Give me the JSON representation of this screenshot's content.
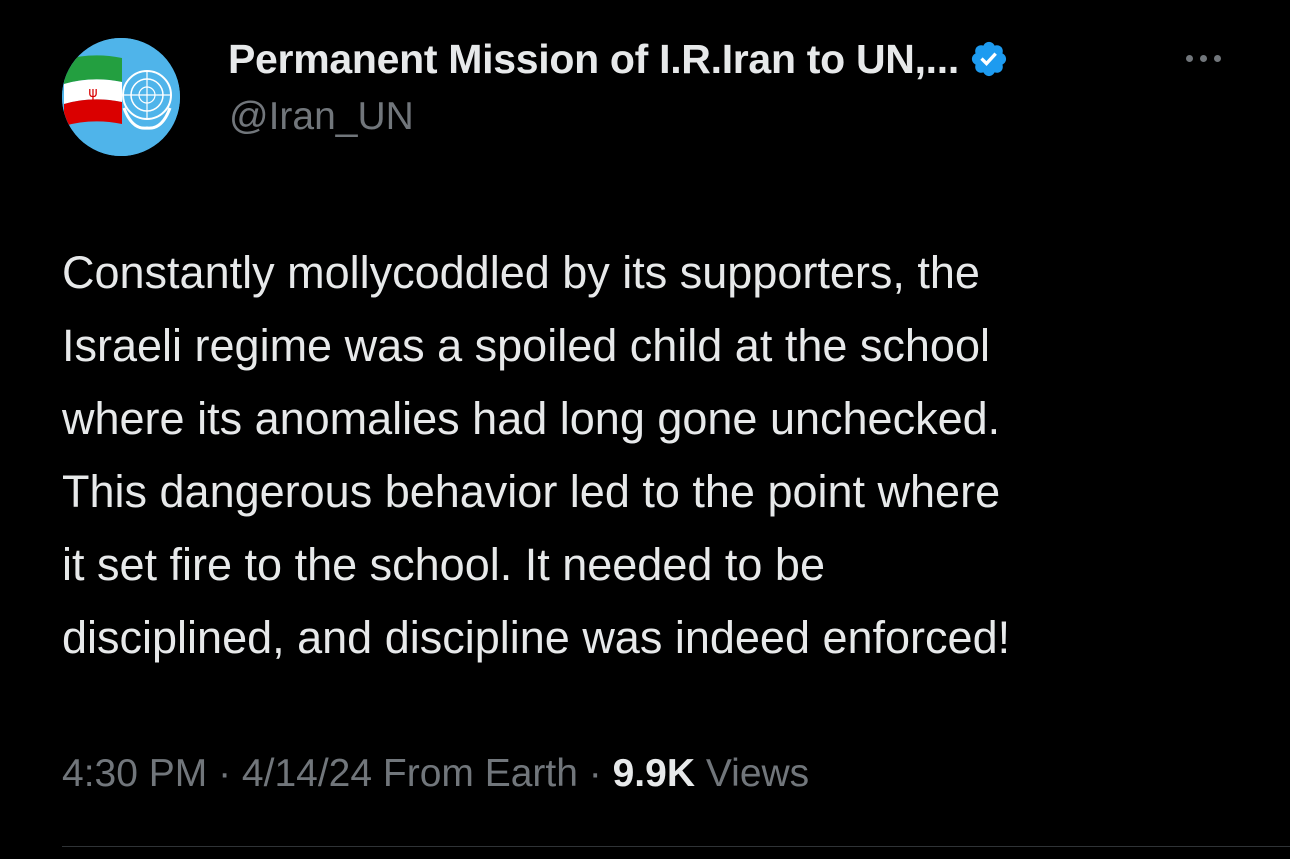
{
  "author": {
    "display_name": "Permanent Mission of I.R.Iran to UN,...",
    "handle": "@Iran_UN",
    "verified": true,
    "avatar_icon": "iran-flag-un-emblem-avatar"
  },
  "menu": {
    "icon": "more-options-icon"
  },
  "tweet": {
    "lines": [
      "Constantly mollycoddled by its supporters, the",
      "Israeli regime was a spoiled child at the school",
      "where its anomalies had long gone unchecked.",
      "This dangerous behavior led to the point where",
      "it set fire to the school. It needed to be",
      "disciplined, and discipline was indeed enforced!"
    ]
  },
  "meta": {
    "time": "4:30 PM",
    "separator": " · ",
    "date": "4/14/24",
    "source": "From Earth",
    "views_count": "9.9K",
    "views_label": "Views"
  },
  "colors": {
    "background": "#000000",
    "text_primary": "#e7e9ea",
    "text_secondary": "#71767b",
    "verified_blue": "#1d9bf0",
    "divider": "#2f3336",
    "avatar_bg": "#4fb4ea"
  }
}
